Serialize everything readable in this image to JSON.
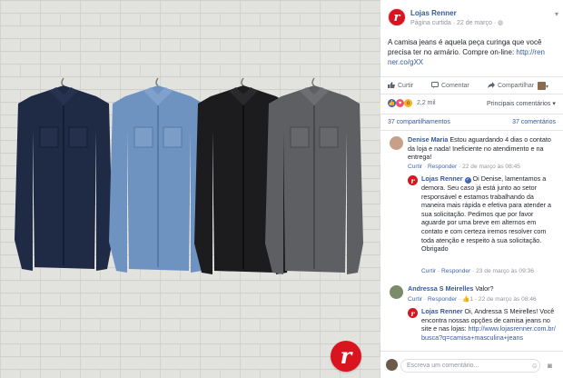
{
  "page": {
    "name": "Lojas Renner",
    "meta": "Página curtida · 22 de março ·",
    "logo_letter": "r"
  },
  "post": {
    "text": "A camisa jeans é aquela peça curinga que você precisa ter no armário. Compre on-line:",
    "link": "http://ren ner.co/gXX"
  },
  "actions": {
    "like": "Curtir",
    "comment": "Comentar",
    "share": "Compartilhar"
  },
  "reactions": {
    "count": "2,2 mil",
    "sort": "Principais comentários ▾",
    "shares": "37 compartilhamentos",
    "comments": "37 comentários",
    "colors": {
      "like": "#4267b2",
      "love": "#f25268",
      "wow": "#f7b125"
    }
  },
  "comments": [
    {
      "author": "Denise Maria",
      "text": "Estou aguardando 4 dias o contato da loja e nada! Ineficiente no atendimento e na entrega!",
      "like": "Curtir",
      "reply": "Responder",
      "time": "22 de março às 08:45"
    },
    {
      "author": "Lojas Renner",
      "text": "Oi Denise, lamentamos a demora. Seu caso já está junto ao setor responsável e estamos trabalhando da maneira mais rápida e efetiva para atender a sua solicitação. Pedimos que por favor aguarde por uma breve em alternos em contato e com certeza iremos resolver com toda atenção e respeito à sua solicitação.",
      "signoff": "Obrigado",
      "like": "Curtir",
      "reply": "Responder",
      "time": "23 de março às 09:36"
    },
    {
      "author": "Andressa S Meirelles",
      "text": "Valor?",
      "like": "Curtir",
      "reply": "Responder",
      "likes": "1",
      "time": "22 de março às 08:46"
    },
    {
      "author": "Lojas Renner",
      "text": "Oi, Andressa S Meirelles! Você encontra nossas opções de camisa jeans no site e nas lojas:",
      "link": "http://www.lojasrenner.com.br/busca?q=camisa+masculina+jeans",
      "like": "Curtir",
      "reply": "Responder",
      "time": "22 de março às 09:53"
    }
  ],
  "composer": {
    "placeholder": "Escreva um comentário...",
    "icons": "☺ ◙"
  }
}
